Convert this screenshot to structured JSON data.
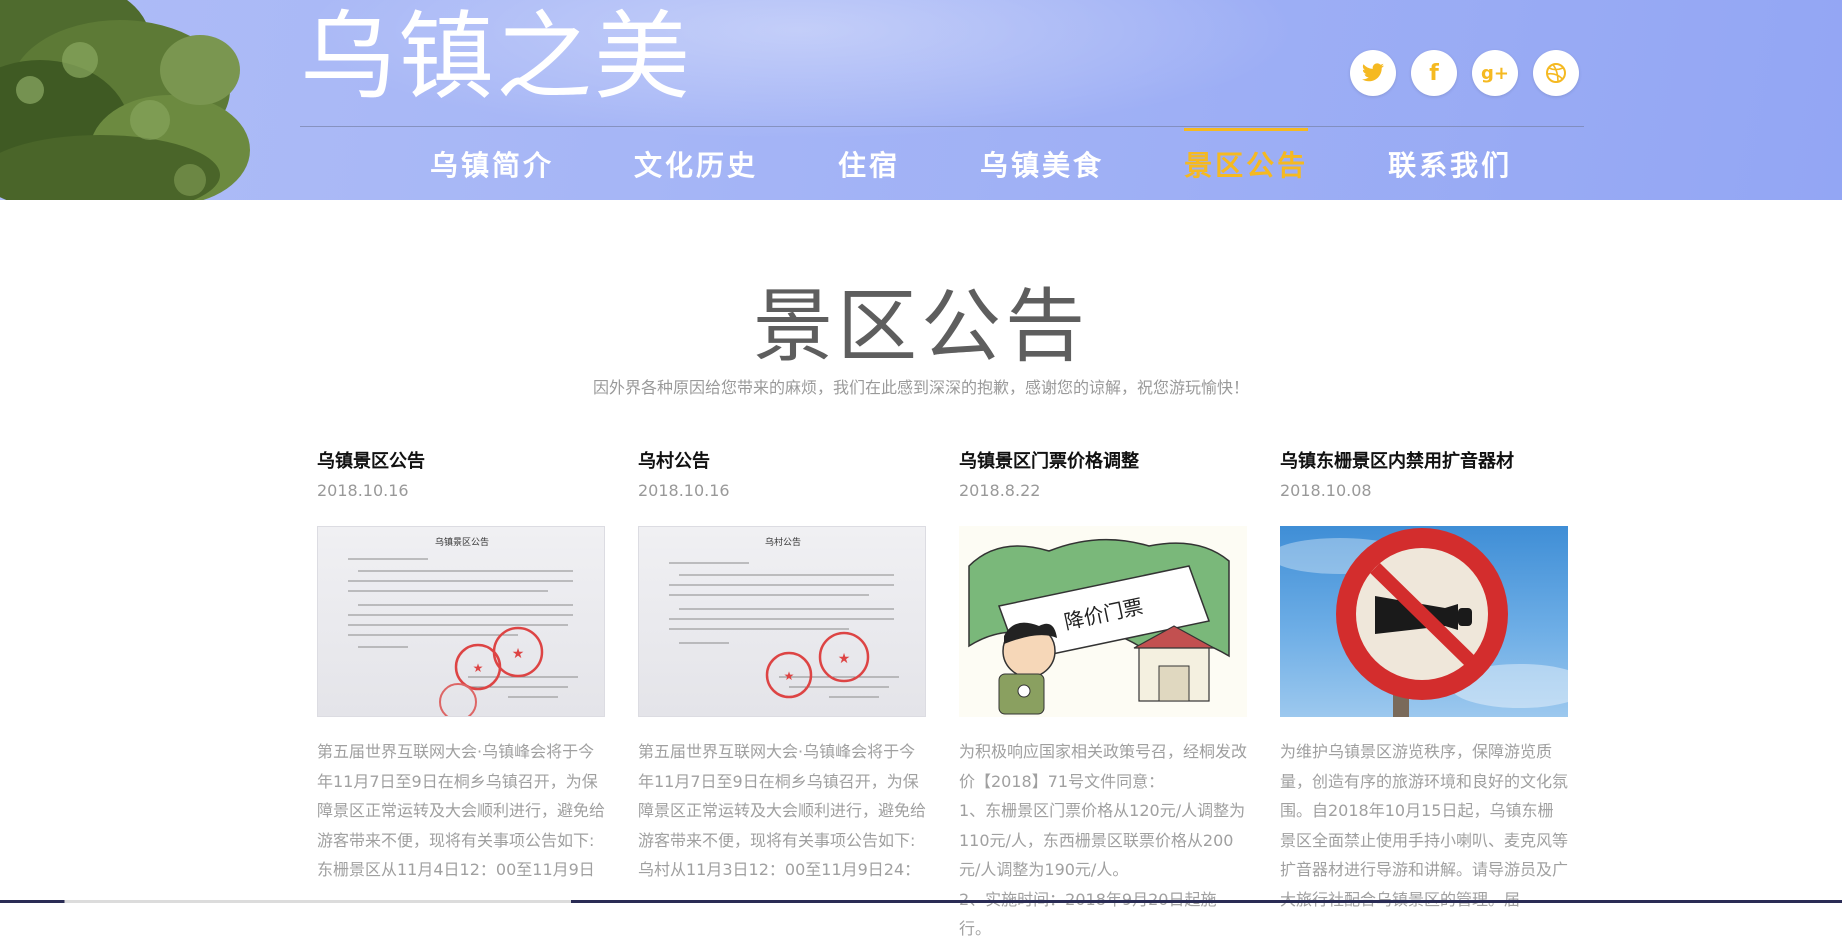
{
  "header": {
    "site_title": "乌镇之美",
    "social": [
      {
        "icon": "twitter-icon",
        "glyph": "🐦"
      },
      {
        "icon": "facebook-icon",
        "glyph": "f"
      },
      {
        "icon": "google-plus-icon",
        "glyph": "g+"
      },
      {
        "icon": "dribbble-icon",
        "glyph": "◎"
      }
    ],
    "nav": [
      {
        "label": "乌镇简介",
        "active": false
      },
      {
        "label": "文化历史",
        "active": false
      },
      {
        "label": "住宿",
        "active": false
      },
      {
        "label": "乌镇美食",
        "active": false
      },
      {
        "label": "景区公告",
        "active": true
      },
      {
        "label": "联系我们",
        "active": false
      }
    ]
  },
  "colors": {
    "accent": "#f5b921",
    "header_bg": "#a6b6f6",
    "body_text": "#a0a0a0"
  },
  "section": {
    "title": "景区公告",
    "subtitle": "因外界各种原因给您带来的麻烦，我们在此感到深深的抱歉，感谢您的谅解，祝您游玩愉快！"
  },
  "cards": [
    {
      "title": "乌镇景区公告",
      "date": "2018.10.16",
      "image": "notice-document",
      "image_heading": "乌镇景区公告",
      "text": "第五届世界互联网大会·乌镇峰会将于今年11月7日至9日在桐乡乌镇召开，为保障景区正常运转及大会顺利进行，避免给游客带来不便，现将有关事项公告如下:\n东栅景区从11月4日12：00至11月9日"
    },
    {
      "title": "乌村公告",
      "date": "2018.10.16",
      "image": "notice-document",
      "image_heading": "乌村公告",
      "text": "第五届世界互联网大会·乌镇峰会将于今年11月7日至9日在桐乡乌镇召开，为保障景区正常运转及大会顺利进行，避免给游客带来不便，现将有关事项公告如下:\n乌村从11月3日12：00至11月9日24："
    },
    {
      "title": "乌镇景区门票价格调整",
      "date": "2018.8.22",
      "image": "ticket-price-cartoon",
      "image_heading": "降价门票",
      "text": "为积极响应国家相关政策号召，经桐发改价【2018】71号文件同意：\n1、东栅景区门票价格从120元/人调整为110元/人，东西栅景区联票价格从200元/人调整为190元/人。\n2、实施时间：2018年9月20日起施行。"
    },
    {
      "title": "乌镇东栅景区内禁用扩音器材",
      "date": "2018.10.08",
      "image": "no-horn-sign",
      "image_heading": "",
      "text": "为维护乌镇景区游览秩序，保障游览质量，创造有序的旅游环境和良好的文化氛围。自2018年10月15日起，乌镇东栅景区全面禁止使用手持小喇叭、麦克风等扩音器材进行导游和讲解。请导游员及广大旅行社配合乌镇景区的管理。届"
    }
  ]
}
